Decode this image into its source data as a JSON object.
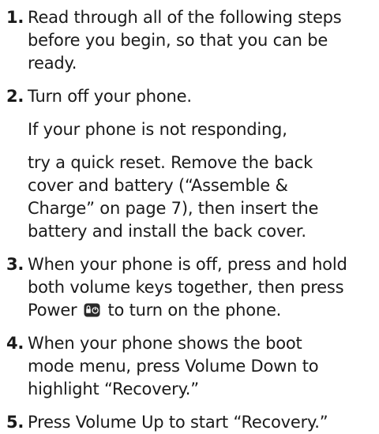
{
  "steps": [
    {
      "number": "1.",
      "lines": [
        "Read through all of the following steps",
        "before you begin, so that you can be",
        "ready."
      ]
    },
    {
      "number": "2.",
      "lines": [
        "Turn off your phone."
      ]
    },
    {
      "number": "3.",
      "lines": [
        "When your phone is off, press and hold",
        "both volume keys together, then press"
      ],
      "last_line_before_icon": "Power",
      "last_line_after_icon": "to turn on the phone.",
      "icon": "power-lock-key-icon"
    },
    {
      "number": "4.",
      "lines": [
        "When your phone shows the boot",
        "mode menu, press Volume Down to",
        "highlight “Recovery.”"
      ]
    },
    {
      "number": "5.",
      "lines": [
        "Press Volume Up to start “Recovery.”"
      ]
    }
  ],
  "step2_notes": [
    "If your phone is not responding,",
    "try a quick reset. Remove the back",
    "cover and battery (“Assemble &",
    "Charge” on page 7), then insert the",
    "battery and install the back cover."
  ]
}
